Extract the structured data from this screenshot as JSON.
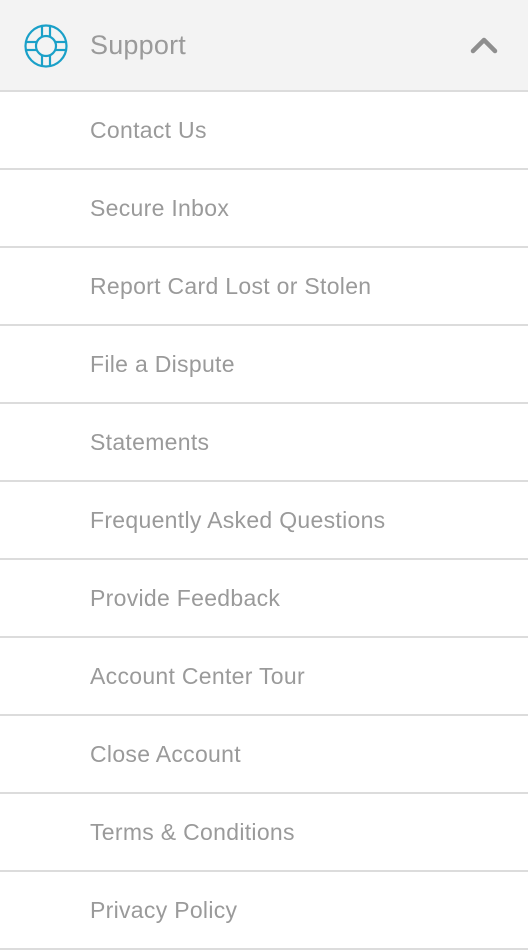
{
  "header": {
    "title": "Support",
    "icon": "lifebuoy-icon",
    "toggle_icon": "chevron-up-icon",
    "accent_color": "#1aa0c8"
  },
  "items": [
    {
      "label": "Contact Us"
    },
    {
      "label": "Secure Inbox"
    },
    {
      "label": "Report Card Lost or Stolen"
    },
    {
      "label": "File a Dispute"
    },
    {
      "label": "Statements"
    },
    {
      "label": "Frequently Asked Questions"
    },
    {
      "label": "Provide Feedback"
    },
    {
      "label": "Account Center Tour"
    },
    {
      "label": "Close Account"
    },
    {
      "label": "Terms & Conditions"
    },
    {
      "label": "Privacy Policy"
    }
  ]
}
